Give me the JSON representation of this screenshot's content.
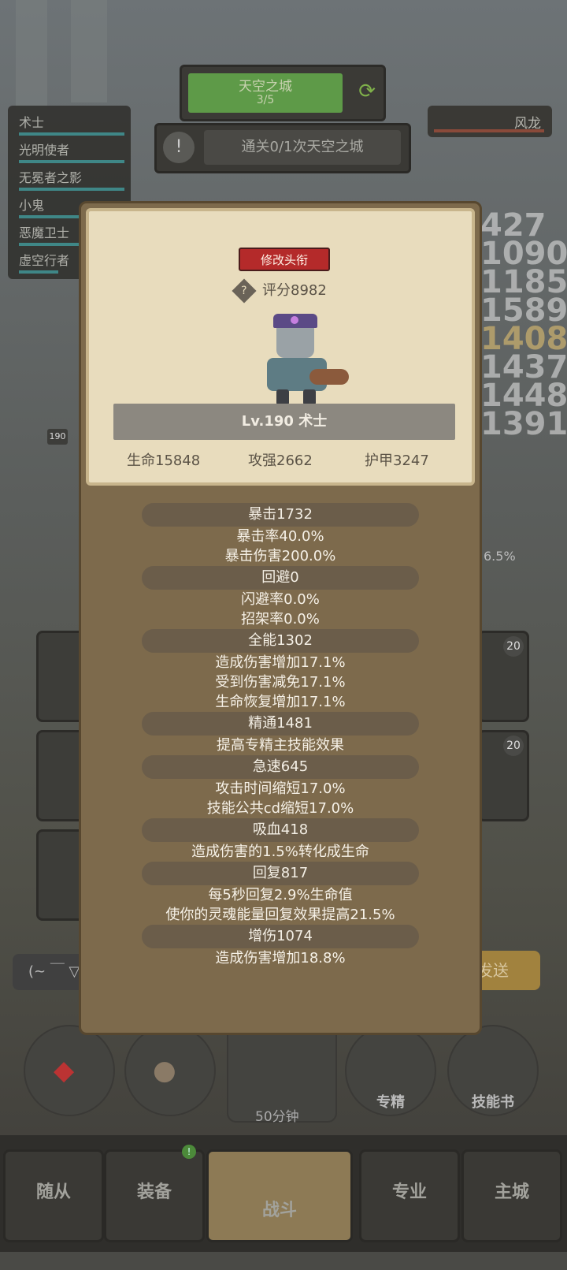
{
  "background": {
    "stage": {
      "name": "天空之城",
      "progress": "3/5"
    },
    "quest": "通关0/1次天空之城",
    "party": [
      "术士",
      "光明使者",
      "无冕者之影",
      "小鬼",
      "恶魔卫士",
      "虚空行者"
    ],
    "boss": "风龙",
    "damage_numbers": [
      "427",
      "1090",
      "1185",
      "1589",
      "1408",
      "1437",
      "1448",
      "1391"
    ],
    "level_tag": "190",
    "percent": "6.5%",
    "slot_badges": [
      "20",
      "20"
    ],
    "chat_placeholder": "(~ ￣ ▽",
    "send_label": "发送",
    "circle_buttons": [
      "专精",
      "技能书"
    ],
    "timer": "50分钟",
    "nav": [
      "随从",
      "装备",
      "战斗",
      "专业",
      "主城"
    ],
    "nav_badge": "!"
  },
  "panel": {
    "change_title_btn": "修改头衔",
    "score": "评分8982",
    "help_icon": "?",
    "name": "Lv.190 术士",
    "stats": [
      "生命15848",
      "攻强2662",
      "护甲3247"
    ],
    "sections": [
      {
        "head": "暴击1732",
        "lines": [
          "暴击率40.0%",
          "暴击伤害200.0%"
        ]
      },
      {
        "head": "回避0",
        "lines": [
          "闪避率0.0%",
          "招架率0.0%"
        ]
      },
      {
        "head": "全能1302",
        "lines": [
          "造成伤害增加17.1%",
          "受到伤害减免17.1%",
          "生命恢复增加17.1%"
        ]
      },
      {
        "head": "精通1481",
        "lines": [
          "提高专精主技能效果"
        ]
      },
      {
        "head": "急速645",
        "lines": [
          "攻击时间缩短17.0%",
          "技能公共cd缩短17.0%"
        ]
      },
      {
        "head": "吸血418",
        "lines": [
          "造成伤害的1.5%转化成生命"
        ]
      },
      {
        "head": "回复817",
        "lines": [
          "每5秒回复2.9%生命值",
          "使你的灵魂能量回复效果提高21.5%"
        ]
      },
      {
        "head": "增伤1074",
        "lines": [
          "造成伤害增加18.8%"
        ]
      }
    ]
  }
}
